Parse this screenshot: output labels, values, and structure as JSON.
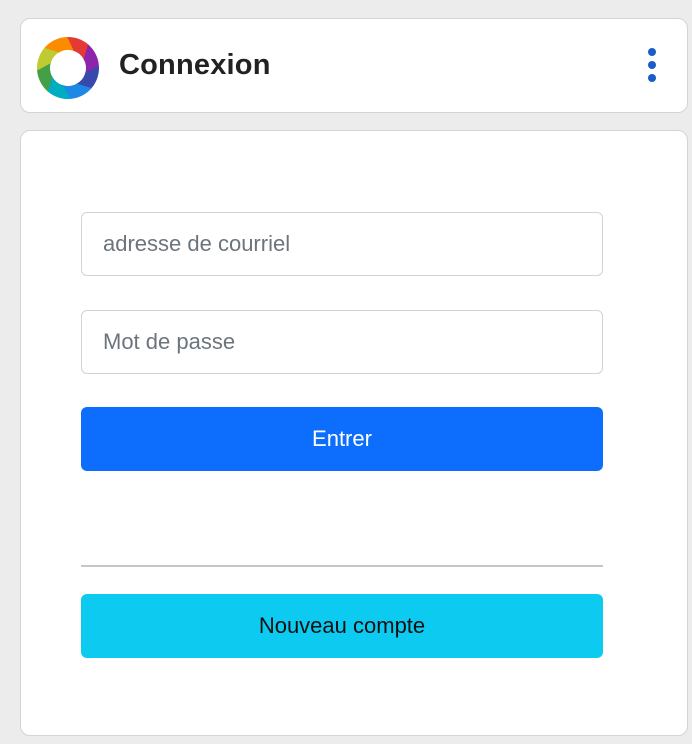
{
  "header": {
    "title": "Connexion",
    "logo_icon": "aperture-logo-icon",
    "menu_icon": "more-vertical-icon"
  },
  "login": {
    "email_placeholder": "adresse de courriel",
    "email_value": "",
    "password_placeholder": "Mot de passe",
    "password_value": "",
    "submit_label": "Entrer",
    "new_account_label": "Nouveau compte"
  },
  "colors": {
    "primary_button": "#0d6efd",
    "secondary_button": "#0dcaf0",
    "menu_dots": "#1a5cc8",
    "background": "#ececec"
  }
}
